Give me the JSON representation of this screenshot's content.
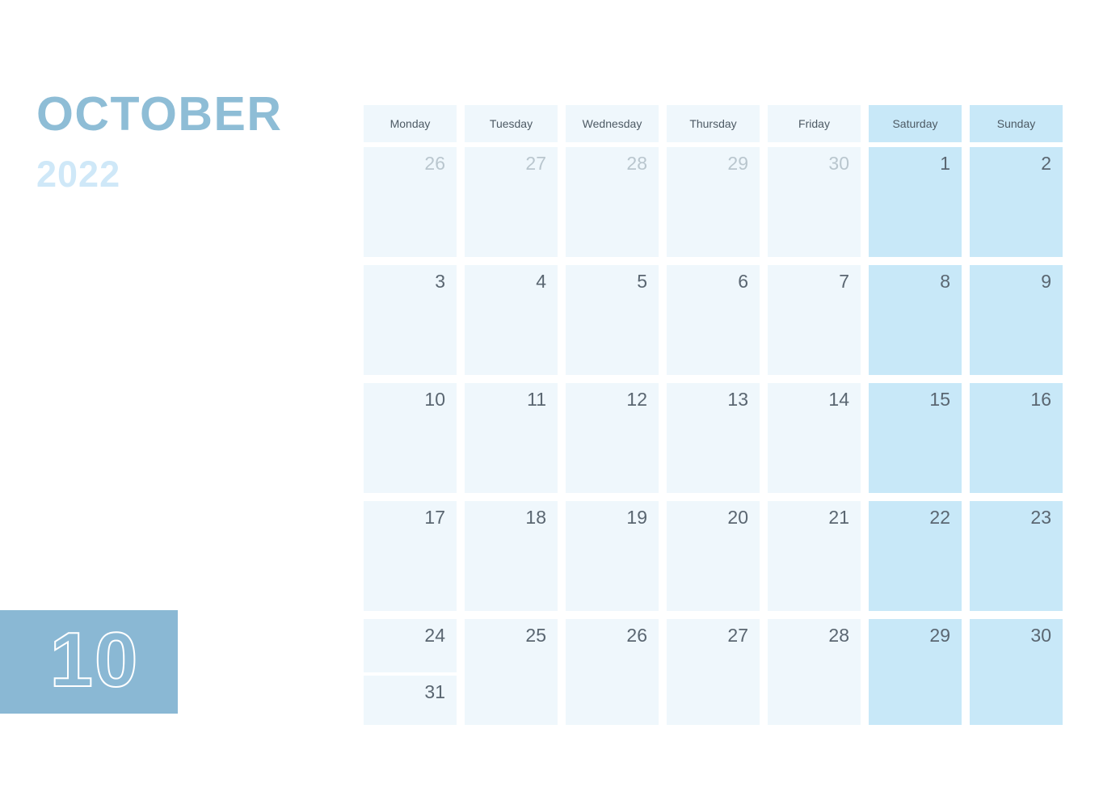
{
  "header": {
    "month_name": "OCTOBER",
    "year": "2022",
    "month_number": "10"
  },
  "weekdays": [
    {
      "label": "Monday",
      "weekend": false
    },
    {
      "label": "Tuesday",
      "weekend": false
    },
    {
      "label": "Wednesday",
      "weekend": false
    },
    {
      "label": "Thursday",
      "weekend": false
    },
    {
      "label": "Friday",
      "weekend": false
    },
    {
      "label": "Saturday",
      "weekend": true
    },
    {
      "label": "Sunday",
      "weekend": true
    }
  ],
  "weeks": [
    {
      "days": [
        {
          "num": "26",
          "other_month": true,
          "weekend": false
        },
        {
          "num": "27",
          "other_month": true,
          "weekend": false
        },
        {
          "num": "28",
          "other_month": true,
          "weekend": false
        },
        {
          "num": "29",
          "other_month": true,
          "weekend": false
        },
        {
          "num": "30",
          "other_month": true,
          "weekend": false
        },
        {
          "num": "1",
          "other_month": false,
          "weekend": true
        },
        {
          "num": "2",
          "other_month": false,
          "weekend": true
        }
      ]
    },
    {
      "days": [
        {
          "num": "3",
          "other_month": false,
          "weekend": false
        },
        {
          "num": "4",
          "other_month": false,
          "weekend": false
        },
        {
          "num": "5",
          "other_month": false,
          "weekend": false
        },
        {
          "num": "6",
          "other_month": false,
          "weekend": false
        },
        {
          "num": "7",
          "other_month": false,
          "weekend": false
        },
        {
          "num": "8",
          "other_month": false,
          "weekend": true
        },
        {
          "num": "9",
          "other_month": false,
          "weekend": true
        }
      ]
    },
    {
      "days": [
        {
          "num": "10",
          "other_month": false,
          "weekend": false
        },
        {
          "num": "11",
          "other_month": false,
          "weekend": false
        },
        {
          "num": "12",
          "other_month": false,
          "weekend": false
        },
        {
          "num": "13",
          "other_month": false,
          "weekend": false
        },
        {
          "num": "14",
          "other_month": false,
          "weekend": false
        },
        {
          "num": "15",
          "other_month": false,
          "weekend": true
        },
        {
          "num": "16",
          "other_month": false,
          "weekend": true
        }
      ]
    },
    {
      "days": [
        {
          "num": "17",
          "other_month": false,
          "weekend": false
        },
        {
          "num": "18",
          "other_month": false,
          "weekend": false
        },
        {
          "num": "19",
          "other_month": false,
          "weekend": false
        },
        {
          "num": "20",
          "other_month": false,
          "weekend": false
        },
        {
          "num": "21",
          "other_month": false,
          "weekend": false
        },
        {
          "num": "22",
          "other_month": false,
          "weekend": true
        },
        {
          "num": "23",
          "other_month": false,
          "weekend": true
        }
      ]
    },
    {
      "last": true,
      "days": [
        {
          "num": "24",
          "other_month": false,
          "weekend": false,
          "extra": "31"
        },
        {
          "num": "25",
          "other_month": false,
          "weekend": false
        },
        {
          "num": "26",
          "other_month": false,
          "weekend": false
        },
        {
          "num": "27",
          "other_month": false,
          "weekend": false
        },
        {
          "num": "28",
          "other_month": false,
          "weekend": false
        },
        {
          "num": "29",
          "other_month": false,
          "weekend": true
        },
        {
          "num": "30",
          "other_month": false,
          "weekend": true
        }
      ]
    }
  ],
  "colors": {
    "title": "#8ebdd6",
    "year": "#cfe8f8",
    "badge_bg": "#8ab8d4",
    "weekday_bg": "#eff7fc",
    "weekend_bg": "#c8e8f8",
    "day_text": "#5a6671",
    "other_month_text": "#b9c6ce"
  }
}
